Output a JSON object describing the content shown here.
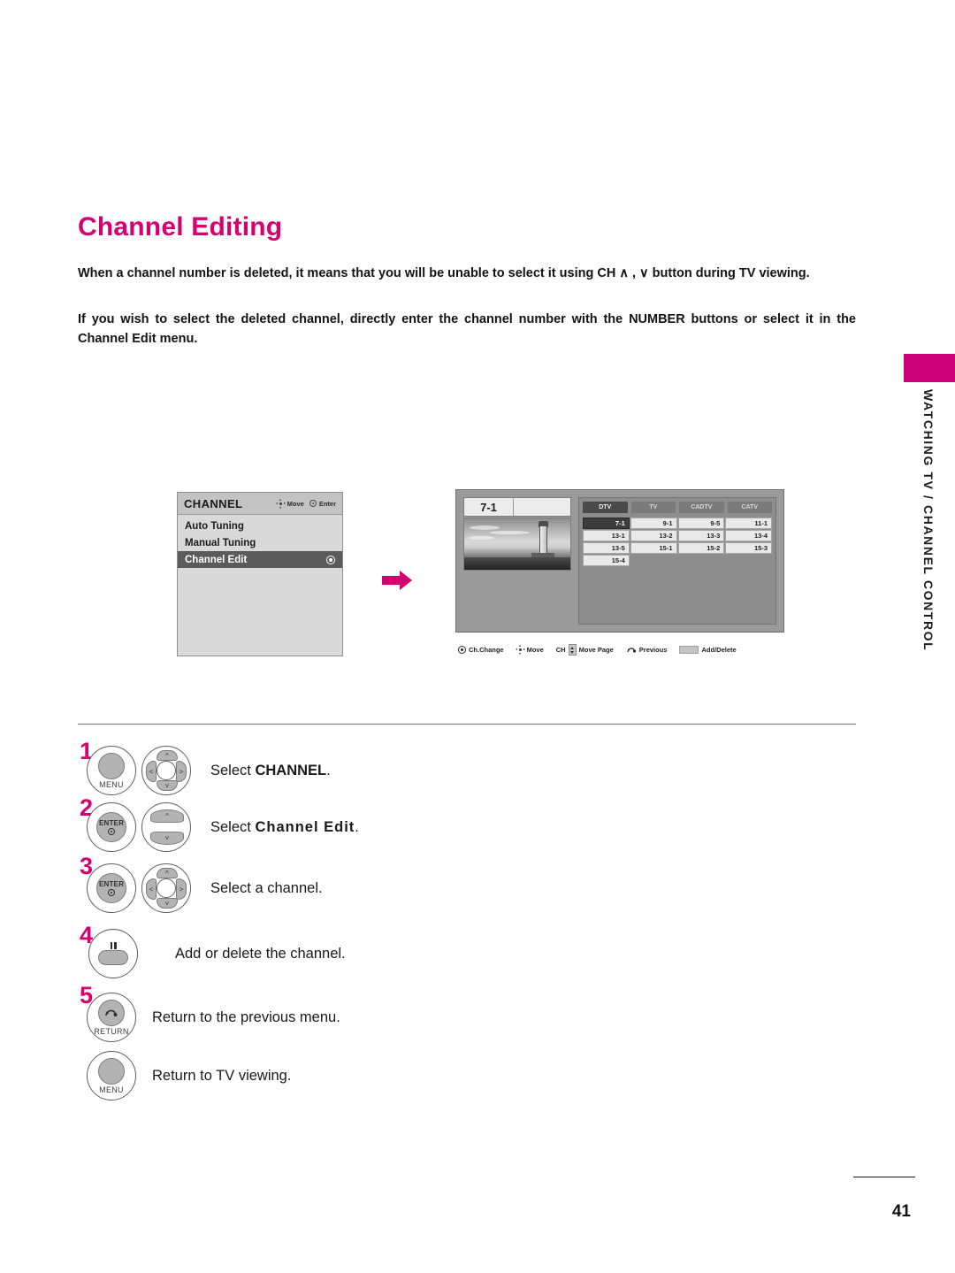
{
  "page": {
    "title": "Channel Editing",
    "number": "41",
    "side_tab": "WATCHING TV / CHANNEL CONTROL",
    "accent_color": "#d6006e",
    "side_tab_color": "#cc0077"
  },
  "intro": {
    "paragraph1": "When a channel number is deleted, it means that you will be unable to select it using CH ∧ , ∨ button during TV viewing.",
    "paragraph2": "If you wish to select the deleted channel, directly enter the channel number with the NUMBER buttons or select it in the Channel Edit menu."
  },
  "osd_menu": {
    "title": "CHANNEL",
    "hints": [
      {
        "icon": "dpad-icon",
        "label": "Move"
      },
      {
        "icon": "enter-icon",
        "label": "Enter"
      }
    ],
    "items": [
      {
        "label": "Auto Tuning",
        "selected": false
      },
      {
        "label": "Manual Tuning",
        "selected": false
      },
      {
        "label": "Channel Edit",
        "selected": true
      }
    ]
  },
  "flow_arrow": {
    "icon": "arrow-right-icon",
    "color": "#d6006e"
  },
  "channel_edit": {
    "preview_channel": "7-1",
    "preview_channel_major": "7",
    "preview_channel_minor": "-1",
    "tabs": [
      {
        "label": "DTV",
        "active": true
      },
      {
        "label": "TV",
        "active": false
      },
      {
        "label": "CADTV",
        "active": false
      },
      {
        "label": "CATV",
        "active": false
      }
    ],
    "grid": [
      {
        "label": "7-1",
        "selected": true
      },
      {
        "label": "9-1",
        "selected": false
      },
      {
        "label": "9-5",
        "selected": false
      },
      {
        "label": "11-1",
        "selected": false
      },
      {
        "label": "13-1",
        "selected": false
      },
      {
        "label": "13-2",
        "selected": false
      },
      {
        "label": "13-3",
        "selected": false
      },
      {
        "label": "13-4",
        "selected": false
      },
      {
        "label": "13-5",
        "selected": false
      },
      {
        "label": "15-1",
        "selected": false
      },
      {
        "label": "15-2",
        "selected": false
      },
      {
        "label": "15-3",
        "selected": false
      },
      {
        "label": "15-4",
        "selected": false
      }
    ],
    "legend": [
      {
        "icon": "enter-ring-icon",
        "label": "Ch.Change"
      },
      {
        "icon": "dpad-icon",
        "label": "Move"
      },
      {
        "icon": "ch-updown-icon",
        "prefix": "CH",
        "label": "Move Page"
      },
      {
        "icon": "return-arrow-icon",
        "label": "Previous"
      },
      {
        "icon": "grey-swatch-icon",
        "label": "Add/Delete"
      }
    ]
  },
  "steps": [
    {
      "number": "1",
      "buttons": [
        "menu-button",
        "dpad-4way"
      ],
      "text_prefix": "Select ",
      "text_bold": "CHANNEL",
      "text_suffix": ".",
      "button_caption": "MENU"
    },
    {
      "number": "2",
      "buttons": [
        "enter-button",
        "dpad-updown"
      ],
      "text_prefix": "Select ",
      "text_bold": "Channel Edit",
      "text_suffix": ".",
      "button_caption": "ENTER"
    },
    {
      "number": "3",
      "buttons": [
        "enter-button",
        "dpad-4way"
      ],
      "text_prefix": "Select a channel.",
      "text_bold": "",
      "text_suffix": "",
      "button_caption": "ENTER"
    },
    {
      "number": "4",
      "buttons": [
        "pause-button"
      ],
      "text_prefix": "Add or delete the channel.",
      "text_bold": "",
      "text_suffix": "",
      "button_caption": ""
    },
    {
      "number": "5",
      "buttons": [
        "return-button"
      ],
      "text_prefix": "Return to the previous menu.",
      "text_bold": "",
      "text_suffix": "",
      "button_caption": "RETURN"
    },
    {
      "number": "",
      "buttons": [
        "menu-button"
      ],
      "text_prefix": "Return to TV viewing.",
      "text_bold": "",
      "text_suffix": "",
      "button_caption": "MENU"
    }
  ]
}
